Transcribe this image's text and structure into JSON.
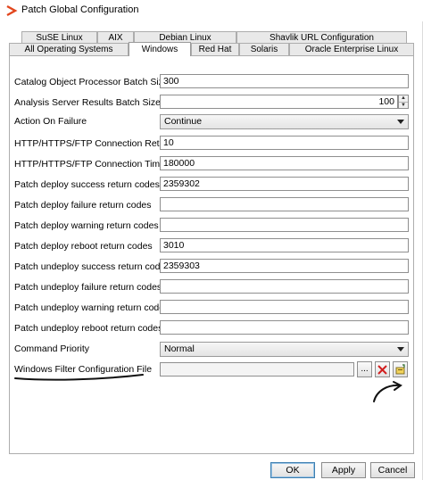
{
  "window": {
    "title": "Patch Global Configuration",
    "app_icon": "ivanti-logo-icon",
    "accent_color": "#e2461d"
  },
  "tabs": {
    "back_row": [
      {
        "label": "SuSE Linux"
      },
      {
        "label": "AIX"
      },
      {
        "label": "Debian Linux"
      },
      {
        "label": "Shavlik URL Configuration"
      }
    ],
    "front_row": [
      {
        "label": "All Operating Systems"
      },
      {
        "label": "Windows",
        "active": true
      },
      {
        "label": "Red Hat"
      },
      {
        "label": "Solaris"
      },
      {
        "label": "Oracle Enterprise Linux"
      }
    ]
  },
  "settings": {
    "catalog_batch": {
      "label": "Catalog Object Processor Batch Size",
      "value": "300"
    },
    "analysis_batch": {
      "label": "Analysis Server Results Batch Size",
      "value": "100"
    },
    "action_on_failure": {
      "label": "Action On Failure",
      "value": "Continue"
    },
    "retry": {
      "label": "HTTP/HTTPS/FTP Connection Retry",
      "value": "10"
    },
    "timeout": {
      "label": "HTTP/HTTPS/FTP Connection Timeout",
      "value": "180000"
    },
    "deploy_success": {
      "label": "Patch deploy success return codes",
      "value": "2359302"
    },
    "deploy_failure": {
      "label": "Patch deploy failure return codes",
      "value": ""
    },
    "deploy_warning": {
      "label": "Patch deploy warning return codes",
      "value": ""
    },
    "deploy_reboot": {
      "label": "Patch deploy reboot return codes",
      "value": "3010"
    },
    "undeploy_success": {
      "label": "Patch undeploy success return codes",
      "value": "2359303"
    },
    "undeploy_failure": {
      "label": "Patch undeploy failure return codes",
      "value": ""
    },
    "undeploy_warning": {
      "label": "Patch undeploy warning return codes",
      "value": ""
    },
    "undeploy_reboot": {
      "label": "Patch undeploy reboot return codes",
      "value": ""
    },
    "command_priority": {
      "label": "Command Priority",
      "value": "Normal"
    },
    "filter_file": {
      "label": "Windows Filter Configuration File",
      "value": "",
      "browse_label": "..."
    }
  },
  "icons": {
    "spin_up": "spin-up-arrow-icon",
    "spin_down": "spin-down-arrow-icon",
    "clear": "red-x-clear-icon",
    "edit": "edit-file-icon",
    "dropdown": "chevron-down-icon"
  },
  "buttons": {
    "ok": "OK",
    "apply": "Apply",
    "cancel": "Cancel"
  }
}
